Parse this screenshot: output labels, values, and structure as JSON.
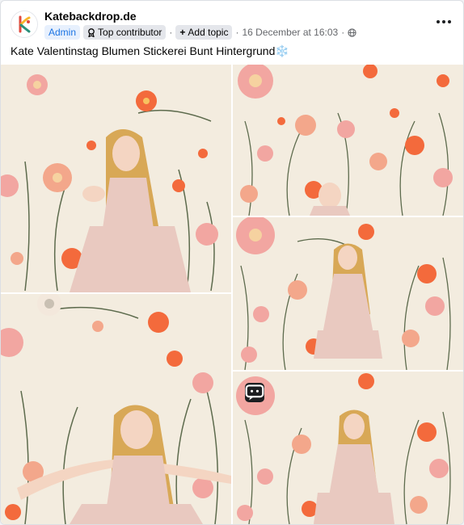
{
  "post": {
    "page_name": "Katebackdrop.de",
    "badges": {
      "admin": "Admin",
      "top_contributor": "Top contributor"
    },
    "add_topic": "Add topic",
    "separator": "·",
    "timestamp": "16 December at 16:03",
    "text": "Kate Valentinstag Blumen Stickerei Bunt Hintergrund❄️"
  },
  "icons": {
    "avatar": "katebackdrop-logo",
    "top_contributor": "award-icon",
    "add_topic": "plus-icon",
    "audience": "globe-icon",
    "more": "more-options-icon",
    "chat": "chat-icon"
  },
  "colors": {
    "brand_blue": "#1b74e4",
    "backdrop": "#f3ecdf",
    "dress": "#e9c9c0",
    "flower_orange": "#f36a3c",
    "flower_pink": "#f2a6a1"
  },
  "photos": [
    {
      "name": "photo-1",
      "subject": "girl blowing kiss"
    },
    {
      "name": "photo-2",
      "subject": "backdrop with small child"
    },
    {
      "name": "photo-3",
      "subject": "girl standing"
    },
    {
      "name": "photo-4",
      "subject": "girl arms outstretched"
    },
    {
      "name": "photo-5",
      "subject": "girl standing full length"
    }
  ]
}
